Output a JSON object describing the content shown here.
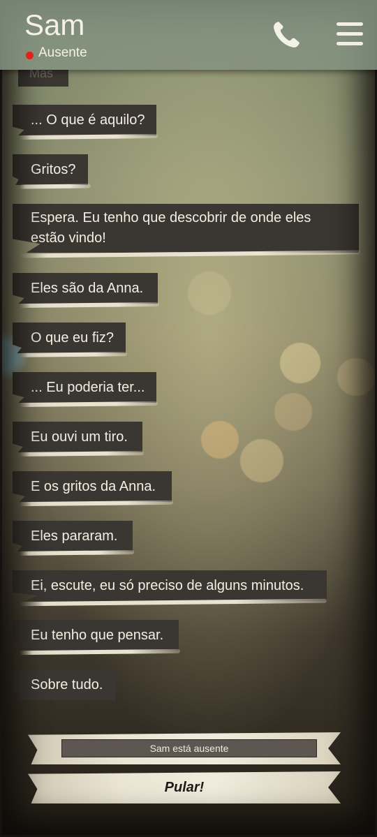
{
  "header": {
    "contact_name": "Sam",
    "status_label": "Ausente",
    "status_color": "#e0221d",
    "call_icon": "phone-icon",
    "menu_icon": "hamburger-menu-icon"
  },
  "chat": {
    "partial_message": "Mas",
    "messages": [
      {
        "text": "... O que é aquilo?"
      },
      {
        "text": "Gritos?"
      },
      {
        "text": "Espera. Eu tenho que descobrir de onde eles estão vindo!"
      },
      {
        "text": "Eles são da Anna."
      },
      {
        "text": "O que eu fiz?"
      },
      {
        "text": "... Eu poderia ter..."
      },
      {
        "text": "Eu ouvi um tiro."
      },
      {
        "text": "E os gritos da Anna."
      },
      {
        "text": "Eles pararam."
      },
      {
        "text": "Ei, escute, eu só preciso de alguns minutos."
      },
      {
        "text": "Eu tenho que pensar."
      },
      {
        "text": "Sobre tudo."
      }
    ]
  },
  "footer": {
    "away_label": "Sam está ausente",
    "skip_label": "Pular!"
  }
}
